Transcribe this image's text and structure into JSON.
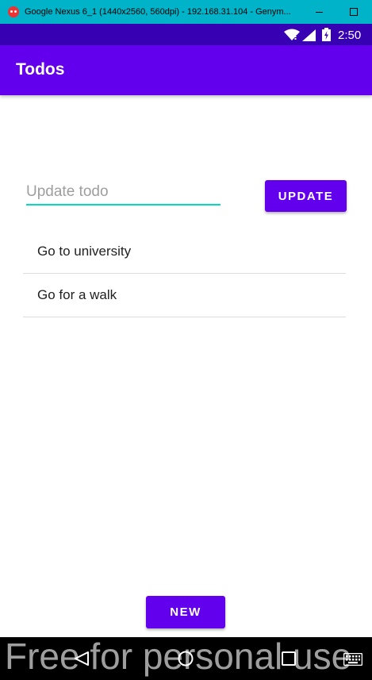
{
  "window": {
    "title": "Google Nexus 6_1 (1440x2560, 560dpi) - 192.168.31.104 - Genym...",
    "icons": [
      "genymotion-logo-icon",
      "minimize-icon",
      "maximize-icon"
    ]
  },
  "status_bar": {
    "time": "2:50",
    "icons": [
      "wifi-icon",
      "signal-icon",
      "battery-icon"
    ]
  },
  "app_bar": {
    "title": "Todos"
  },
  "editor": {
    "placeholder": "Update todo",
    "value": "",
    "update_label": "UPDATE"
  },
  "todos": [
    {
      "text": "Go to university"
    },
    {
      "text": "Go for a walk"
    }
  ],
  "footer": {
    "new_label": "NEW"
  },
  "nav_bar": {
    "icons": [
      "back-icon",
      "home-icon",
      "recents-icon",
      "keyboard-icon"
    ]
  },
  "watermark": {
    "text": "Free for personal use"
  },
  "colors": {
    "primary": "#6200ee",
    "primary_dark": "#3700b3",
    "accent": "#03dac5",
    "window_bar": "#00b3c9"
  }
}
